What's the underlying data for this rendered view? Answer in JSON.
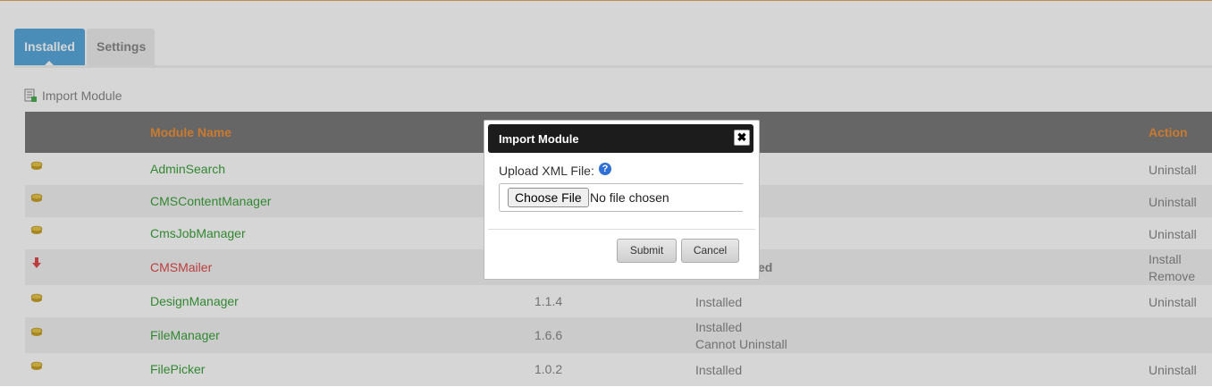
{
  "tabs": [
    {
      "label": "Installed",
      "active": true
    },
    {
      "label": "Settings",
      "active": false
    }
  ],
  "import_link": {
    "label": "Import Module",
    "icon": "import-icon"
  },
  "table": {
    "headers": {
      "name": "Module Name",
      "action": "Action"
    },
    "rows": [
      {
        "icon": "module-icon",
        "name": "AdminSearch",
        "version": "",
        "status": [
          "",
          ""
        ],
        "action": [
          "Uninstall",
          ""
        ]
      },
      {
        "icon": "module-icon",
        "name": "CMSContentManager",
        "version": "",
        "status": [
          "",
          ""
        ],
        "action": [
          "Uninstall",
          ""
        ]
      },
      {
        "icon": "module-icon",
        "name": "CmsJobManager",
        "version": "",
        "status": [
          "",
          ""
        ],
        "action": [
          "Uninstall",
          ""
        ]
      },
      {
        "icon": "download-arrow-icon",
        "name": "CMSMailer",
        "version": "",
        "status": [
          "ed",
          ""
        ],
        "action": [
          "Install",
          "Remove"
        ]
      },
      {
        "icon": "module-icon",
        "name": "DesignManager",
        "version": "1.1.4",
        "status": [
          "Installed",
          ""
        ],
        "action": [
          "Uninstall",
          ""
        ]
      },
      {
        "icon": "module-icon",
        "name": "FileManager",
        "version": "1.6.6",
        "status": [
          "Installed",
          "Cannot Uninstall"
        ],
        "action": [
          "",
          ""
        ]
      },
      {
        "icon": "module-icon",
        "name": "FilePicker",
        "version": "1.0.2",
        "status": [
          "Installed",
          ""
        ],
        "action": [
          "Uninstall",
          ""
        ]
      }
    ]
  },
  "dialog": {
    "title": "Import Module",
    "close_icon": "close-icon",
    "upload_label": "Upload XML File:",
    "help_glyph": "?",
    "choose_button": "Choose File",
    "no_file_text": "No file chosen",
    "submit_label": "Submit",
    "cancel_label": "Cancel"
  },
  "colors": {
    "accent": "#58a8dc",
    "header_text": "#f0923a",
    "link": "#3ca33c",
    "uninstalled": "#e04b4b"
  }
}
